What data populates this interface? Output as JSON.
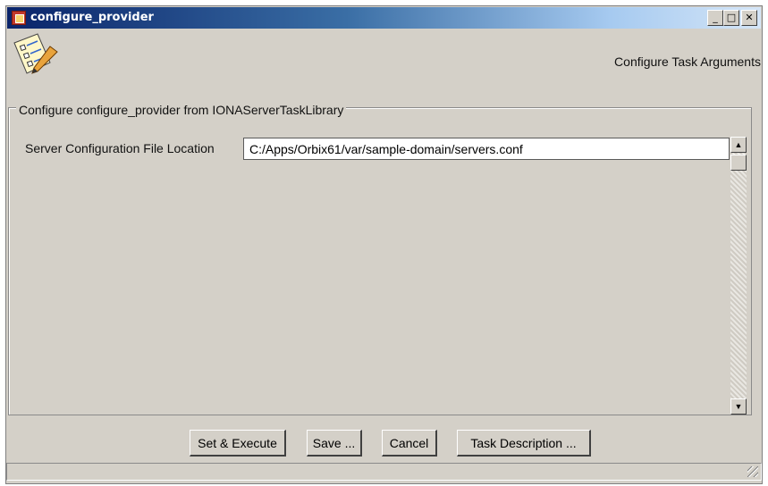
{
  "window": {
    "title": "configure_provider",
    "minimize_glyph": "_",
    "maximize_glyph": "□",
    "close_glyph": "✕"
  },
  "header": {
    "task_icon": "checklist-pencil-icon",
    "subtitle": "Configure Task Arguments"
  },
  "group": {
    "legend": "Configure configure_provider from IONAServerTaskLibrary",
    "field_label": "Server Configuration File Location",
    "field_value": "C:/Apps/Orbix61/var/sample-domain/servers.conf"
  },
  "scrollbar": {
    "up_glyph": "▲",
    "down_glyph": "▼"
  },
  "buttons": {
    "set_execute": "Set & Execute",
    "save": "Save ...",
    "cancel": "Cancel",
    "task_description": "Task Description ..."
  },
  "colors": {
    "face": "#d4d0c8",
    "title_start": "#0a246a",
    "title_end": "#d4e5f7"
  }
}
